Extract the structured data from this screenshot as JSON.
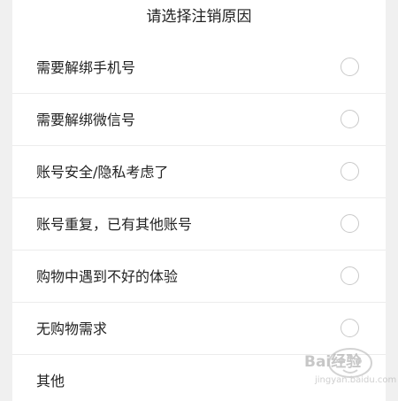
{
  "dialog": {
    "title": "请选择注销原因",
    "reasons": [
      {
        "label": "需要解绑手机号",
        "has_radio": true,
        "selected": false
      },
      {
        "label": "需要解绑微信号",
        "has_radio": true,
        "selected": false
      },
      {
        "label": "账号安全/隐私考虑了",
        "has_radio": true,
        "selected": false
      },
      {
        "label": "账号重复，已有其他账号",
        "has_radio": true,
        "selected": false
      },
      {
        "label": "购物中遇到不好的体验",
        "has_radio": true,
        "selected": false
      },
      {
        "label": "无购物需求",
        "has_radio": true,
        "selected": false
      },
      {
        "label": "其他",
        "has_radio": false,
        "selected": false
      }
    ]
  },
  "watermark": {
    "text": "Bai经验",
    "sub": "jingyan.baidu.com"
  },
  "colors": {
    "background": "#f0f0f0",
    "sheet": "#ffffff",
    "text": "#222222",
    "divider": "#ececec",
    "radio_border": "#c9c9c9"
  },
  "icons": {
    "radio": "radio-unchecked-icon",
    "watermark": "baidu-jingyan-logo"
  }
}
